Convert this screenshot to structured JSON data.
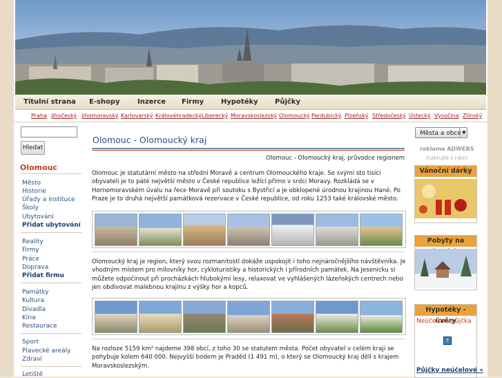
{
  "main_nav": [
    "Titulní strana",
    "E-shopy",
    "Inzerce",
    "Firmy",
    "Hypotéky",
    "Půjčky"
  ],
  "regions": [
    "Praha",
    "Jihočeský",
    "Jihomoravský",
    "Karlovarský",
    "Královéhradecký",
    "Liberecký",
    "Moravskoslezský",
    "Olomoucký",
    "Pardubický",
    "Plzeňský",
    "Středočeský",
    "Ústecký",
    "Vysočina",
    "Zlínský"
  ],
  "search": {
    "value": "",
    "button": "Hledat"
  },
  "left": {
    "city": "Olomouc",
    "group1": [
      "Město",
      "Historie",
      "Úřady a instituce",
      "Školy",
      "Ubytování"
    ],
    "group1_bold": "Přidat ubytování",
    "group2": [
      "Reality",
      "Firmy",
      "Práce",
      "Doprava"
    ],
    "group2_bold": "Přidat firmu",
    "group3": [
      "Památky",
      "Kultura",
      "Divadla",
      "Kina",
      "Restaurace"
    ],
    "group4": [
      "Sport",
      "Plavecké areály",
      "Zdraví"
    ],
    "group5": [
      "Letiště"
    ]
  },
  "content": {
    "title": "Olomouc - Olomoucký kraj",
    "subtitle": "Olomouc - Olomoucký kraj, průvodce regionem",
    "para1": "Olomouc je statutární město na střední Moravě a centrum Olomouckého kraje. Se svými sto tisíci obyvateli je to páté největší město v České republice ležící přímo v srdci Moravy. Rozkládá se v Hornomoravském úvalu na řece Moravě při soutoku s Bystřicí a je obklopené úrodnou krajinou Hané. Po Praze je to druhá největší památková rezervace v České republice, od roku 1253 také královské město.",
    "para2": "Olomoucký kraj je region, který svou rozmanitostí dokáže uspokojit i toho nejnáročnějšího návštěvníka. Je vhodným místem pro milovníky hor, cykloturistiky a historických i přírodních památek. Na Jesenicku si můžete odpočinout při procházkách hlubokými lesy, relaxovat ve vyhlášených lázeňských centrech nebo jen obdivovat malebnou krajinu z výšky hor a kopců.",
    "para3": "Na rozloze 5159 km² najdeme 398 obcí, z toho 30 se statutem města. Počet obyvatel v celém kraji se pohybuje kolem 640 000. Nejvyšší bodem je Praděd (1 491 m), o který se Olomoucký kraj dělí s krajem Moravskoslezským."
  },
  "right": {
    "select": "Města a obce",
    "ad_label": "reklama ADWEBS",
    "ad_sub": "inzerujte s námi",
    "box1": "Vánoční dárky",
    "box2": "Pobyty na horách",
    "box3": "Hypotéky - úvěry",
    "box3_link": "Neúčelová půjčka",
    "box3_bottom": "Půjčky neúčelové »"
  },
  "colors": {
    "accent_red": "#c23a1e",
    "link_blue": "#2c4f86",
    "box_header": "#e9a23d"
  }
}
